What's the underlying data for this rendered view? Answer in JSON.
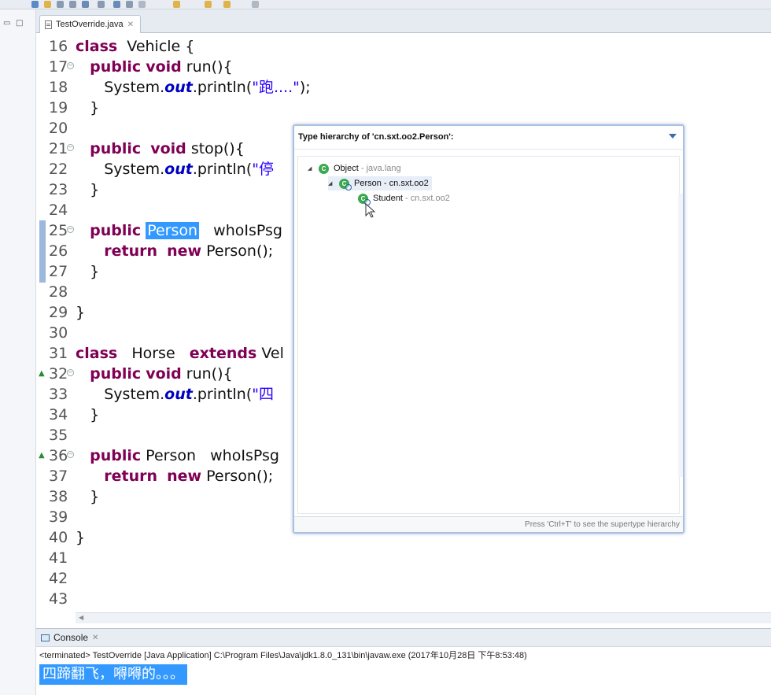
{
  "editor": {
    "tab_label": "TestOverride.java",
    "lines": [
      {
        "num": "16",
        "marker": "",
        "fold": false,
        "tokens": [
          {
            "t": "class",
            "c": "kw"
          },
          {
            "t": "  Vehicle {",
            "c": ""
          }
        ]
      },
      {
        "num": "17",
        "marker": "",
        "fold": true,
        "tokens": [
          {
            "t": "   ",
            "c": ""
          },
          {
            "t": "public",
            "c": "kw"
          },
          {
            "t": " ",
            "c": ""
          },
          {
            "t": "void",
            "c": "kw"
          },
          {
            "t": " run(){",
            "c": ""
          }
        ]
      },
      {
        "num": "18",
        "marker": "",
        "fold": false,
        "tokens": [
          {
            "t": "      System.",
            "c": ""
          },
          {
            "t": "out",
            "c": "fld"
          },
          {
            "t": ".println(",
            "c": ""
          },
          {
            "t": "\"跑....\"",
            "c": "str"
          },
          {
            "t": ");",
            "c": ""
          }
        ]
      },
      {
        "num": "19",
        "marker": "",
        "fold": false,
        "tokens": [
          {
            "t": "   }",
            "c": ""
          }
        ]
      },
      {
        "num": "20",
        "marker": "",
        "fold": false,
        "tokens": []
      },
      {
        "num": "21",
        "marker": "",
        "fold": true,
        "tokens": [
          {
            "t": "   ",
            "c": ""
          },
          {
            "t": "public",
            "c": "kw"
          },
          {
            "t": "  ",
            "c": ""
          },
          {
            "t": "void",
            "c": "kw"
          },
          {
            "t": " stop(){",
            "c": ""
          }
        ]
      },
      {
        "num": "22",
        "marker": "",
        "fold": false,
        "tokens": [
          {
            "t": "      System.",
            "c": ""
          },
          {
            "t": "out",
            "c": "fld"
          },
          {
            "t": ".println(",
            "c": ""
          },
          {
            "t": "\"停",
            "c": "str"
          }
        ]
      },
      {
        "num": "23",
        "marker": "",
        "fold": false,
        "tokens": [
          {
            "t": "   }",
            "c": ""
          }
        ]
      },
      {
        "num": "24",
        "marker": "",
        "fold": false,
        "tokens": []
      },
      {
        "num": "25",
        "marker": "",
        "fold": true,
        "tokens": [
          {
            "t": "   ",
            "c": ""
          },
          {
            "t": "public",
            "c": "kw"
          },
          {
            "t": " ",
            "c": ""
          },
          {
            "t": "Person",
            "c": "sel"
          },
          {
            "t": "   whoIsPsg",
            "c": ""
          }
        ]
      },
      {
        "num": "26",
        "marker": "",
        "fold": false,
        "tokens": [
          {
            "t": "      ",
            "c": ""
          },
          {
            "t": "return",
            "c": "kw"
          },
          {
            "t": "  ",
            "c": ""
          },
          {
            "t": "new",
            "c": "kw"
          },
          {
            "t": " Person();",
            "c": ""
          }
        ]
      },
      {
        "num": "27",
        "marker": "",
        "fold": false,
        "tokens": [
          {
            "t": "   }",
            "c": ""
          }
        ]
      },
      {
        "num": "28",
        "marker": "",
        "fold": false,
        "tokens": []
      },
      {
        "num": "29",
        "marker": "",
        "fold": false,
        "tokens": [
          {
            "t": "}",
            "c": ""
          }
        ]
      },
      {
        "num": "30",
        "marker": "",
        "fold": false,
        "tokens": []
      },
      {
        "num": "31",
        "marker": "",
        "fold": false,
        "tokens": [
          {
            "t": "class",
            "c": "kw"
          },
          {
            "t": "   Horse   ",
            "c": ""
          },
          {
            "t": "extends",
            "c": "kw"
          },
          {
            "t": " Vel",
            "c": ""
          }
        ]
      },
      {
        "num": "32",
        "marker": "▲",
        "fold": true,
        "tokens": [
          {
            "t": "   ",
            "c": ""
          },
          {
            "t": "public",
            "c": "kw"
          },
          {
            "t": " ",
            "c": ""
          },
          {
            "t": "void",
            "c": "kw"
          },
          {
            "t": " run(){",
            "c": ""
          }
        ]
      },
      {
        "num": "33",
        "marker": "",
        "fold": false,
        "tokens": [
          {
            "t": "      System.",
            "c": ""
          },
          {
            "t": "out",
            "c": "fld"
          },
          {
            "t": ".println(",
            "c": ""
          },
          {
            "t": "\"四",
            "c": "str"
          }
        ]
      },
      {
        "num": "34",
        "marker": "",
        "fold": false,
        "tokens": [
          {
            "t": "   }",
            "c": ""
          }
        ]
      },
      {
        "num": "35",
        "marker": "",
        "fold": false,
        "tokens": []
      },
      {
        "num": "36",
        "marker": "▲",
        "fold": true,
        "tokens": [
          {
            "t": "   ",
            "c": ""
          },
          {
            "t": "public",
            "c": "kw"
          },
          {
            "t": " Person   whoIsPsg",
            "c": ""
          }
        ]
      },
      {
        "num": "37",
        "marker": "",
        "fold": false,
        "tokens": [
          {
            "t": "      ",
            "c": ""
          },
          {
            "t": "return",
            "c": "kw"
          },
          {
            "t": "  ",
            "c": ""
          },
          {
            "t": "new",
            "c": "kw"
          },
          {
            "t": " Person();",
            "c": ""
          }
        ]
      },
      {
        "num": "38",
        "marker": "",
        "fold": false,
        "tokens": [
          {
            "t": "   }",
            "c": ""
          }
        ]
      },
      {
        "num": "39",
        "marker": "",
        "fold": false,
        "tokens": []
      },
      {
        "num": "40",
        "marker": "",
        "fold": false,
        "tokens": [
          {
            "t": "}",
            "c": ""
          }
        ]
      },
      {
        "num": "41",
        "marker": "",
        "fold": false,
        "tokens": []
      },
      {
        "num": "42",
        "marker": "",
        "fold": false,
        "tokens": []
      },
      {
        "num": "43",
        "marker": "",
        "fold": false,
        "tokens": []
      }
    ]
  },
  "popup": {
    "title": "Type hierarchy of 'cn.sxt.oo2.Person':",
    "tree": [
      {
        "name": "Object",
        "package": "java.lang",
        "separator": " - ",
        "twisty": "◢",
        "icon": "class-icon",
        "focus": false,
        "highlight": false
      },
      {
        "name": "Person",
        "package": "cn.sxt.oo2",
        "separator": " - ",
        "twisty": "◢",
        "icon": "class-icon",
        "focus": true,
        "highlight": true
      },
      {
        "name": "Student",
        "package": "cn.sxt.oo2",
        "separator": " - ",
        "twisty": "",
        "icon": "class-icon",
        "focus": true,
        "highlight": false
      }
    ],
    "hint": "Press 'Ctrl+T' to see the supertype hierarchy"
  },
  "console": {
    "tab_label": "Console",
    "status": "<terminated> TestOverride [Java Application] C:\\Program Files\\Java\\jdk1.8.0_131\\bin\\javaw.exe (2017年10月28日 下午8:53:48)",
    "output": "四蹄翻飞，嘚嘚的。。。"
  },
  "colors": {
    "keyword": "#7f0055",
    "field": "#0000c0",
    "string": "#2a00ff",
    "selection": "#3399ff",
    "class_icon": "#3aa84f"
  }
}
